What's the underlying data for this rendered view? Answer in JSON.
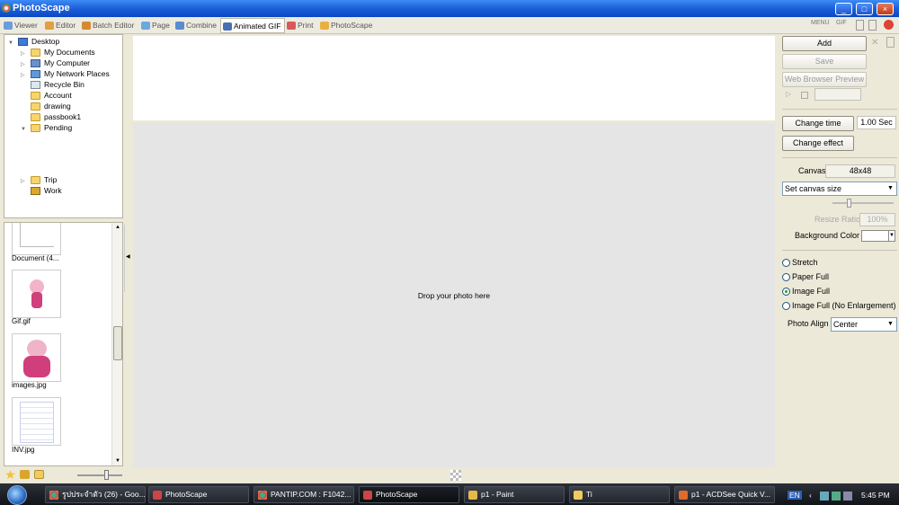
{
  "window": {
    "title": "PhotoScape",
    "min": "_",
    "max": "□",
    "close": "×"
  },
  "tabs": [
    {
      "label": "Viewer"
    },
    {
      "label": "Editor"
    },
    {
      "label": "Batch Editor"
    },
    {
      "label": "Page"
    },
    {
      "label": "Combine"
    },
    {
      "label": "Animated GIF"
    },
    {
      "label": "Print"
    },
    {
      "label": "PhotoScape"
    }
  ],
  "topright": {
    "menu": "MENU",
    "gif": "GIF"
  },
  "tree": [
    "Desktop",
    "My Documents",
    "My Computer",
    "My Network Places",
    "Recycle Bin",
    "Account",
    "drawing",
    "passbook1",
    "Pending",
    "Trip",
    "Work"
  ],
  "thumbnails": [
    "Document (4...",
    "Gif.gif",
    "images.jpg",
    "INV.jpg"
  ],
  "main": {
    "drop_text": "Drop your photo here"
  },
  "right": {
    "add": "Add",
    "save": "Save",
    "web_preview": "Web Browser Preview",
    "change_time": "Change time",
    "time_value": "1.00 Sec",
    "change_effect": "Change effect",
    "canvas_label": "Canvas",
    "canvas_value": "48x48",
    "canvas_size": "Set canvas size",
    "resize_ratio_label": "Resize Ratio",
    "resize_ratio_value": "100%",
    "bg_color_label": "Background Color",
    "radios": [
      "Stretch",
      "Paper Full",
      "Image Full",
      "Image Full (No Enlargement)"
    ],
    "selected_radio": "Image Full",
    "photo_align_label": "Photo Align",
    "photo_align_value": "Center"
  },
  "taskbar": {
    "tasks": [
      "รูปประจำตัว (26) - Goo...",
      "PhotoScape",
      "PANTIP.COM : F1042...",
      "PhotoScape",
      "p1 - Paint",
      "Ti",
      "p1 - ACDSee Quick V..."
    ],
    "lang": "EN",
    "clock": "5:45 PM"
  }
}
